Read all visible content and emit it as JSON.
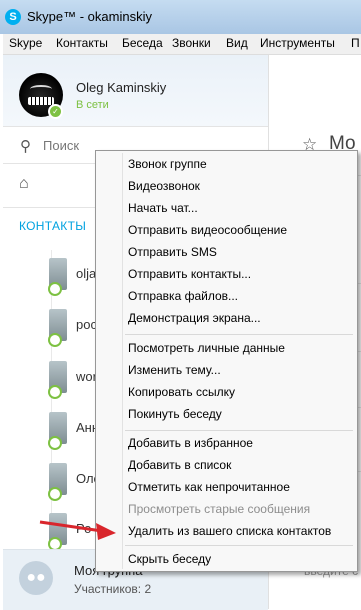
{
  "window": {
    "title": "Skype™ - okaminskiy",
    "app_icon_letter": "S"
  },
  "menubar": [
    "Skype",
    "Контакты",
    "Беседа",
    "Звонки",
    "Вид",
    "Инструменты",
    "П"
  ],
  "profile": {
    "name": "Oleg Kaminskiy",
    "status": "В сети",
    "status_color": "#7dc142"
  },
  "search": {
    "placeholder": "Поиск",
    "icon": "search-icon"
  },
  "home_icon": "home-icon",
  "tabs": {
    "contacts": "КОНТАКТЫ",
    "accent": "#00a2e0"
  },
  "contacts": [
    "olja",
    "poc",
    "wor",
    "Анн",
    "Оле",
    "Ро"
  ],
  "group": {
    "name": "Моя группа",
    "participants": "Участников: 2"
  },
  "right_panel": {
    "title": "Мо",
    "message_hint": "введите с"
  },
  "context_menu": {
    "sections": [
      [
        "Звонок группе",
        "Видеозвонок",
        "Начать чат...",
        "Отправить видеосообщение",
        "Отправить SMS",
        "Отправить контакты...",
        "Отправка файлов...",
        "Демонстрация экрана..."
      ],
      [
        "Посмотреть личные данные",
        "Изменить тему...",
        "Копировать ссылку",
        "Покинуть беседу"
      ],
      [
        "Добавить в избранное",
        "Добавить в список",
        "Отметить как непрочитанное",
        "Просмотреть старые сообщения",
        "Удалить из вашего списка контактов"
      ],
      [
        "Скрыть беседу"
      ]
    ],
    "disabled_item": "Просмотреть старые сообщения",
    "highlighted_item": "Удалить из вашего списка контактов"
  },
  "annotation_arrow_color": "#d9262c"
}
